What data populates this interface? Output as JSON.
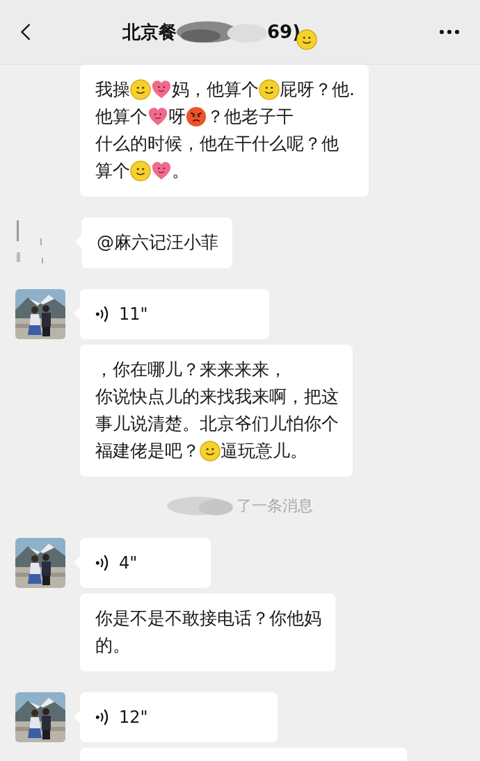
{
  "header": {
    "title_start": "北京餐",
    "title_end": "69)",
    "title_redacted": true,
    "title_sticker": true
  },
  "messages": [
    {
      "kind": "text",
      "lines": [
        {
          "parts": [
            {
              "kind": "text",
              "text": "我操"
            },
            {
              "kind": "smile"
            },
            {
              "kind": "heart"
            },
            {
              "kind": "text",
              "text": "妈，他算个"
            },
            {
              "kind": "smile"
            },
            {
              "kind": "text",
              "text": "屁呀？他."
            }
          ]
        },
        {
          "parts": [
            {
              "kind": "text",
              "text": "他算个"
            },
            {
              "kind": "heart"
            },
            {
              "kind": "text",
              "text": "呀"
            },
            {
              "kind": "angry"
            },
            {
              "kind": "text",
              "text": "？他老子干"
            }
          ]
        },
        {
          "parts": [
            {
              "kind": "text",
              "text": "什么的时候，他在干什么呢？他"
            }
          ]
        },
        {
          "parts": [
            {
              "kind": "text",
              "text": "算个"
            },
            {
              "kind": "smile"
            },
            {
              "kind": "heart"
            },
            {
              "kind": "text",
              "text": "。"
            }
          ]
        }
      ]
    },
    {
      "kind": "text",
      "avatar": {
        "kind": "blurred"
      },
      "lines": [
        {
          "parts": [
            {
              "kind": "text",
              "text": "@麻六记汪小菲"
            }
          ]
        }
      ]
    },
    {
      "kind": "voice",
      "duration": "11\""
    },
    {
      "kind": "text",
      "lines": [
        {
          "parts": [
            {
              "kind": "text",
              "text": "，你在哪儿？来来来来，"
            }
          ]
        },
        {
          "parts": [
            {
              "kind": "text",
              "text": "你说快点儿的来找我来啊，把这"
            }
          ]
        },
        {
          "parts": [
            {
              "kind": "text",
              "text": "事儿说清楚。北京爷们儿怕你个"
            }
          ]
        },
        {
          "parts": [
            {
              "kind": "text",
              "text": "福建佬是吧？"
            },
            {
              "kind": "smile"
            },
            {
              "kind": "text",
              "text": "逼玩意儿。"
            }
          ]
        }
      ]
    },
    {
      "kind": "system",
      "redacted": true,
      "text": "了一条消息"
    },
    {
      "kind": "voice",
      "duration": "4\""
    },
    {
      "kind": "text",
      "lines": [
        {
          "parts": [
            {
              "kind": "text",
              "text": "你是不是不敢接电话？你他妈"
            }
          ]
        },
        {
          "parts": [
            {
              "kind": "text",
              "text": "的。"
            }
          ]
        }
      ]
    },
    {
      "kind": "voice",
      "duration": "12\""
    },
    {
      "kind": "partial"
    }
  ]
}
